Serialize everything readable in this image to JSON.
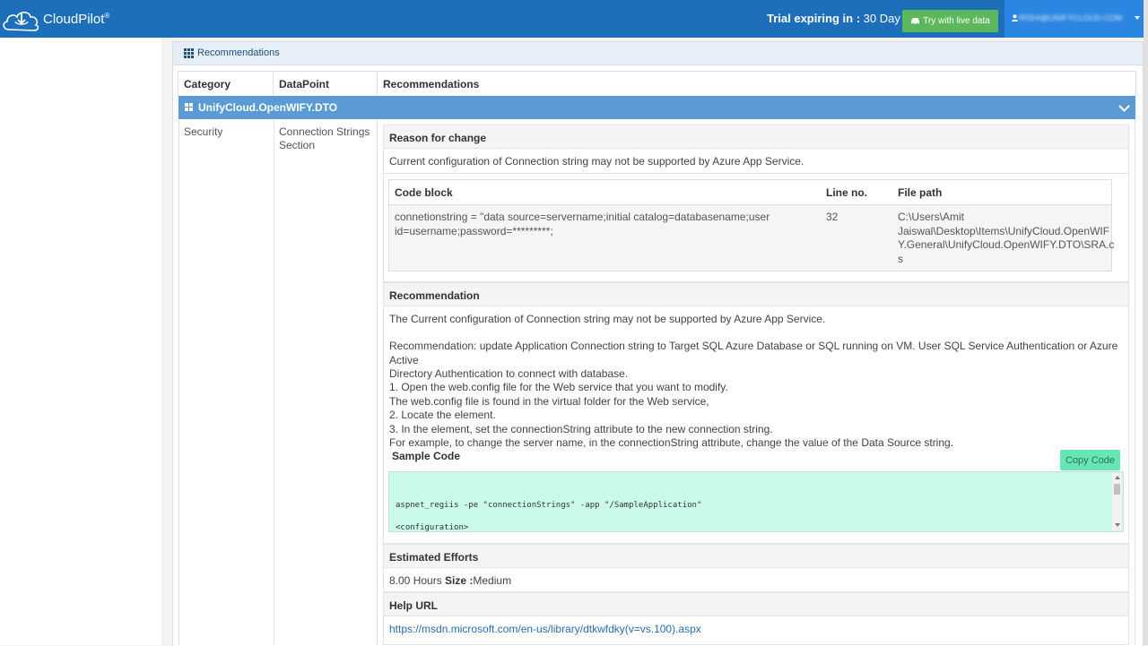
{
  "app": {
    "name": "CloudPilot",
    "registered": "®"
  },
  "header": {
    "trial_label": "Trial expiring in :",
    "trial_value": "30 Day",
    "try_button": "Try with live data",
    "user_email": "RISHI@UNIFYCLOUD.COM"
  },
  "panel": {
    "title": "Recommendations"
  },
  "table": {
    "columns": [
      "Category",
      "DataPoint",
      "Recommendations"
    ],
    "group": "UnifyCloud.OpenWIFY.DTO",
    "row": {
      "category": "Security",
      "datapoint_line1": "Connection Strings",
      "datapoint_line2": "Section"
    }
  },
  "reason": {
    "heading": "Reason for change",
    "text": "Current configuration of Connection string may not be supported by Azure App Service."
  },
  "code_block": {
    "headers": [
      "Code block",
      "Line no.",
      "File path"
    ],
    "code_line1": "connetionstring = \"data source=servername;initial catalog=databasename;user",
    "code_line2": "id=username;password=*********;",
    "line_no": "32",
    "path_line1": "C:\\Users\\Amit",
    "path_line2": "Jaiswal\\Desktop\\Items\\UnifyCloud.OpenWIF",
    "path_line3": "Y.General\\UnifyCloud.OpenWIFY.DTO\\SRA.c",
    "path_line4": "s"
  },
  "recommendation": {
    "heading": "Recommendation",
    "p1": "The Current configuration of Connection string may not be supported by Azure App Service.",
    "p2_line1": "Recommendation: update Application Connection string to Target SQL Azure Database or SQL running on VM. User SQL Service Authentication or Azure Active",
    "p2_line2": "Directory Authentication to connect with database.",
    "s1": "1. Open the web.config file for the Web service that you want to modify.",
    "s2": "The web.config file is found in the virtual folder for the Web service,",
    "s3": "2. Locate the element.",
    "s4": "3. In the element, set the connectionString attribute to the new connection string.",
    "s5": "For example, to change the server name, in the connectionString attribute, change the value of the Data Source string.",
    "sample_code_label": "Sample Code",
    "copy_button": "Copy Code",
    "code_line1": "aspnet_regiis -pe \"connectionStrings\" -app \"/SampleApplication\"",
    "code_line2": "<configuration>"
  },
  "efforts": {
    "heading": "Estimated Efforts",
    "hours": "8.00 Hours",
    "size_label": "Size :",
    "size_value": "Medium"
  },
  "help": {
    "heading": "Help URL",
    "url": "https://msdn.microsoft.com/en-us/library/dtkwfdky(v=vs.100).aspx"
  },
  "colors": {
    "topbar": "#1e6fba",
    "group_row": "#5b9bd5",
    "try_button": "#5cb85c",
    "copy_button": "#66e6b5",
    "code_bg": "#cafaea"
  }
}
